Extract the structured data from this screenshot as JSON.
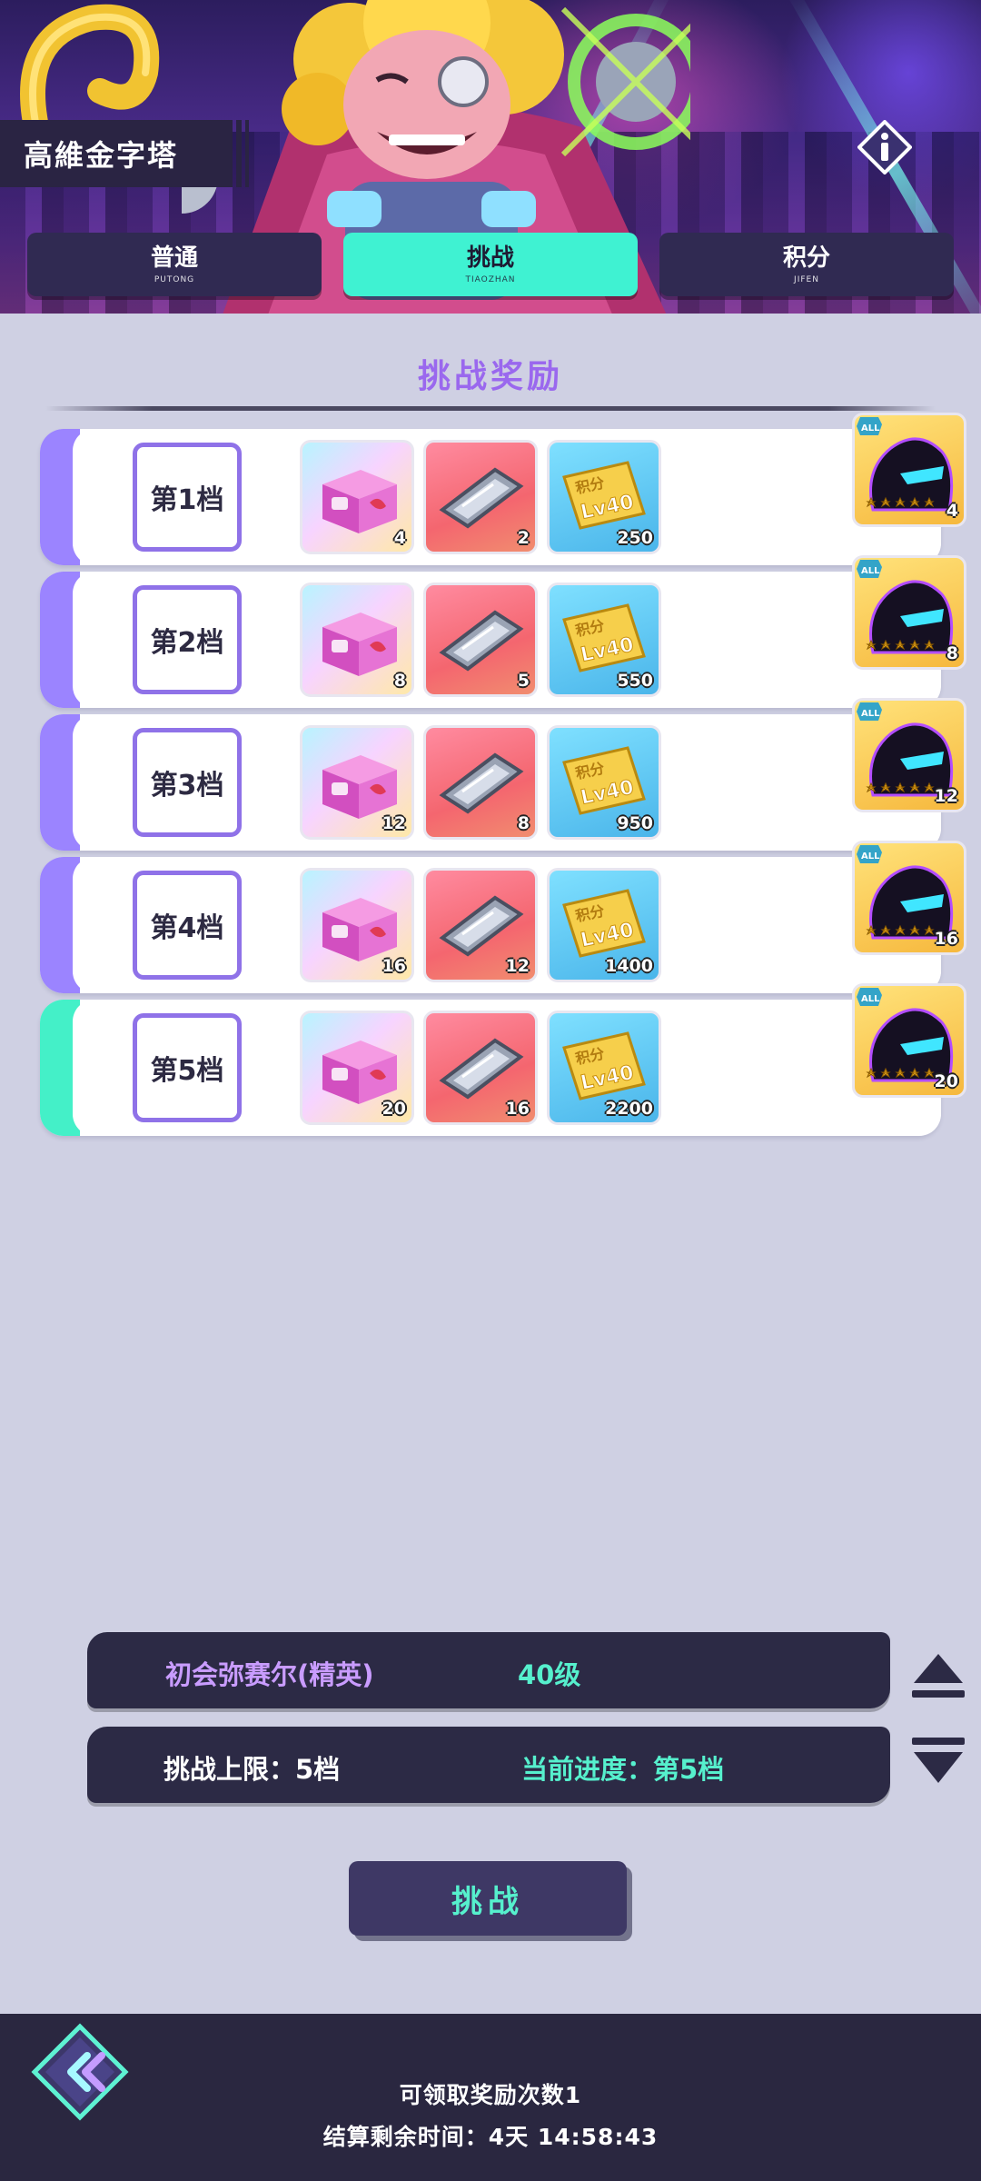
{
  "header": {
    "title": "高維金字塔",
    "info_icon": "info-icon",
    "tabs": [
      {
        "label": "普通",
        "sub": "PUTONG",
        "active": false
      },
      {
        "label": "挑战",
        "sub": "TIAOZHAN",
        "active": true
      },
      {
        "label": "积分",
        "sub": "JIFEN",
        "active": false
      }
    ]
  },
  "section": {
    "title": "挑战奖励"
  },
  "rewards": [
    {
      "tier": "第1档",
      "box": "4",
      "ticket": "2",
      "points": "250",
      "hero": "4"
    },
    {
      "tier": "第2档",
      "box": "8",
      "ticket": "5",
      "points": "550",
      "hero": "8"
    },
    {
      "tier": "第3档",
      "box": "12",
      "ticket": "8",
      "points": "950",
      "hero": "12"
    },
    {
      "tier": "第4档",
      "box": "16",
      "ticket": "12",
      "points": "1400",
      "hero": "16"
    },
    {
      "tier": "第5档",
      "box": "20",
      "ticket": "16",
      "points": "2200",
      "hero": "20"
    }
  ],
  "item_icons": [
    "gift-box-icon",
    "ticket-icon",
    "points-card-icon",
    "hero-silhouette-icon"
  ],
  "points_card_text": {
    "label": "积分",
    "level": "Lv40"
  },
  "hero_badge": "ALL",
  "current_tier_index": 4,
  "opponent": {
    "name": "初会弥赛尔(精英)",
    "level": "40级"
  },
  "progress": {
    "limit": "挑战上限：5档",
    "current": "当前进度：第5档"
  },
  "challenge_button": "挑战",
  "footer": {
    "claims": "可领取奖励次数1",
    "remaining": "结算剩余时间：4天  14:58:43"
  },
  "colors": {
    "accent_purple": "#9b84ff",
    "accent_cyan": "#3ff2d2",
    "title_purple": "#9a68ee",
    "panel_dark": "#2c2a45",
    "opponent_name": "#c99cff",
    "opponent_level": "#56f0cd"
  }
}
